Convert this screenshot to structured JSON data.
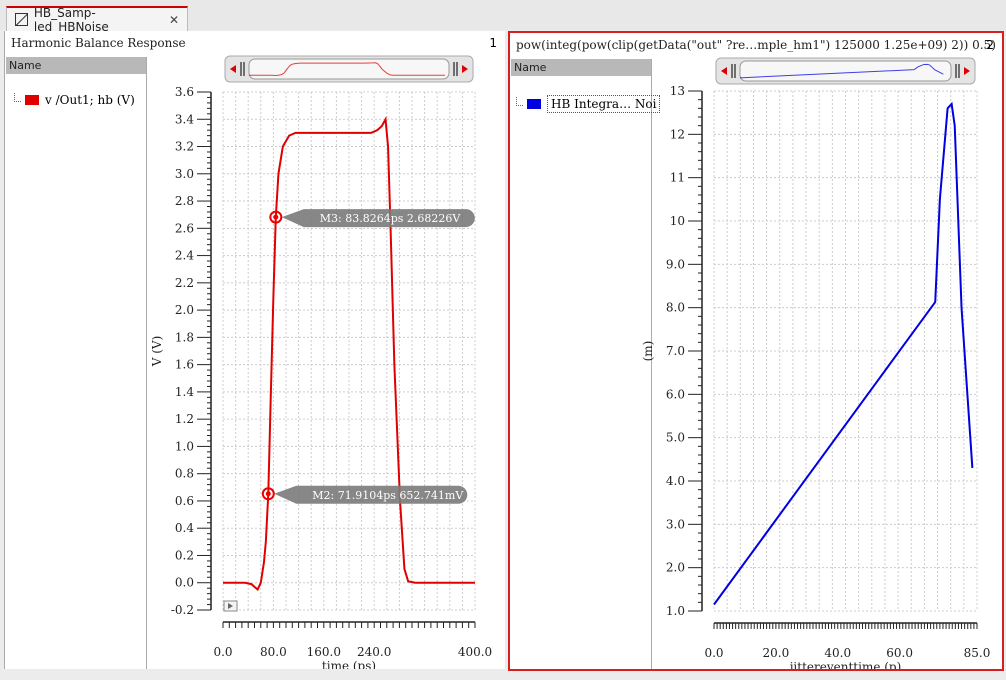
{
  "tab": {
    "title": "HB_Samp-led_HBNoise",
    "close": "✕",
    "icon": "schematic-icon"
  },
  "plot1": {
    "title": "Harmonic Balance Response",
    "number": "1",
    "name_header": "Name",
    "legend": {
      "label": "v /Out1; hb (V)",
      "color": "#e00000"
    },
    "chart_data": {
      "type": "line",
      "xlabel": "time (ps)",
      "ylabel": "V (V)",
      "xlim": [
        0,
        400
      ],
      "ylim": [
        -0.2,
        3.6
      ],
      "xticks": [
        "0.0",
        "80.0",
        "160.0",
        "240.0",
        "400.0"
      ],
      "xtick_values": [
        0,
        80,
        160,
        240,
        400
      ],
      "yticks": [
        "-0.2",
        "0.0",
        "0.2",
        "0.4",
        "0.6",
        "0.8",
        "1.0",
        "1.2",
        "1.4",
        "1.6",
        "1.8",
        "2.0",
        "2.2",
        "2.4",
        "2.6",
        "2.8",
        "3.0",
        "3.2",
        "3.4",
        "3.6"
      ],
      "series": [
        {
          "name": "v /Out1; hb (V)",
          "color": "#e00000",
          "x": [
            0,
            20,
            35,
            45,
            55,
            60,
            65,
            68,
            71.9,
            76,
            80,
            83.8,
            88,
            95,
            105,
            115,
            140,
            200,
            235,
            245,
            252,
            258,
            262,
            266,
            272,
            281,
            288,
            294,
            305,
            400
          ],
          "y": [
            0,
            0,
            0,
            -0.01,
            -0.05,
            0.0,
            0.15,
            0.3,
            0.653,
            1.4,
            2.1,
            2.682,
            3.0,
            3.2,
            3.28,
            3.3,
            3.3,
            3.3,
            3.3,
            3.32,
            3.35,
            3.4,
            3.2,
            2.6,
            1.6,
            0.6,
            0.1,
            0.01,
            0,
            0
          ]
        }
      ],
      "markers": [
        {
          "label": "M3: 83.8264ps 2.68226V",
          "x": 83.8264,
          "y": 2.68226
        },
        {
          "label": "M2: 71.9104ps 652.741mV",
          "x": 71.9104,
          "y": 0.652741
        }
      ]
    }
  },
  "plot2": {
    "title": "pow(integ(pow(clip(getData(\"out\" ?re…mple_hm1\") 125000 1.25e+09) 2)) 0.5)",
    "number": "2",
    "name_header": "Name",
    "legend": {
      "label": "HB Integra… Noi",
      "color": "#0000e0"
    },
    "chart_data": {
      "type": "line",
      "xlabel": "jittereventtime (p)",
      "ylabel": "(m)",
      "xlim": [
        0,
        85
      ],
      "ylim": [
        1,
        13
      ],
      "xticks": [
        "0.0",
        "20.0",
        "40.0",
        "60.0",
        "85.0"
      ],
      "xtick_values": [
        0,
        20,
        40,
        60,
        85
      ],
      "yticks": [
        "1.0",
        "2.0",
        "3.0",
        "4.0",
        "5.0",
        "6.0",
        "7.0",
        "8.0",
        "9.0",
        "10",
        "11",
        "12",
        "13"
      ],
      "series": [
        {
          "name": "HB Integrated Noise",
          "color": "#0000e0",
          "x": [
            0,
            71.5,
            73,
            75.5,
            76.8,
            77.8,
            80,
            83.5
          ],
          "y": [
            1.15,
            8.13,
            10.5,
            12.6,
            12.7,
            12.2,
            8.0,
            4.3
          ]
        }
      ]
    }
  }
}
